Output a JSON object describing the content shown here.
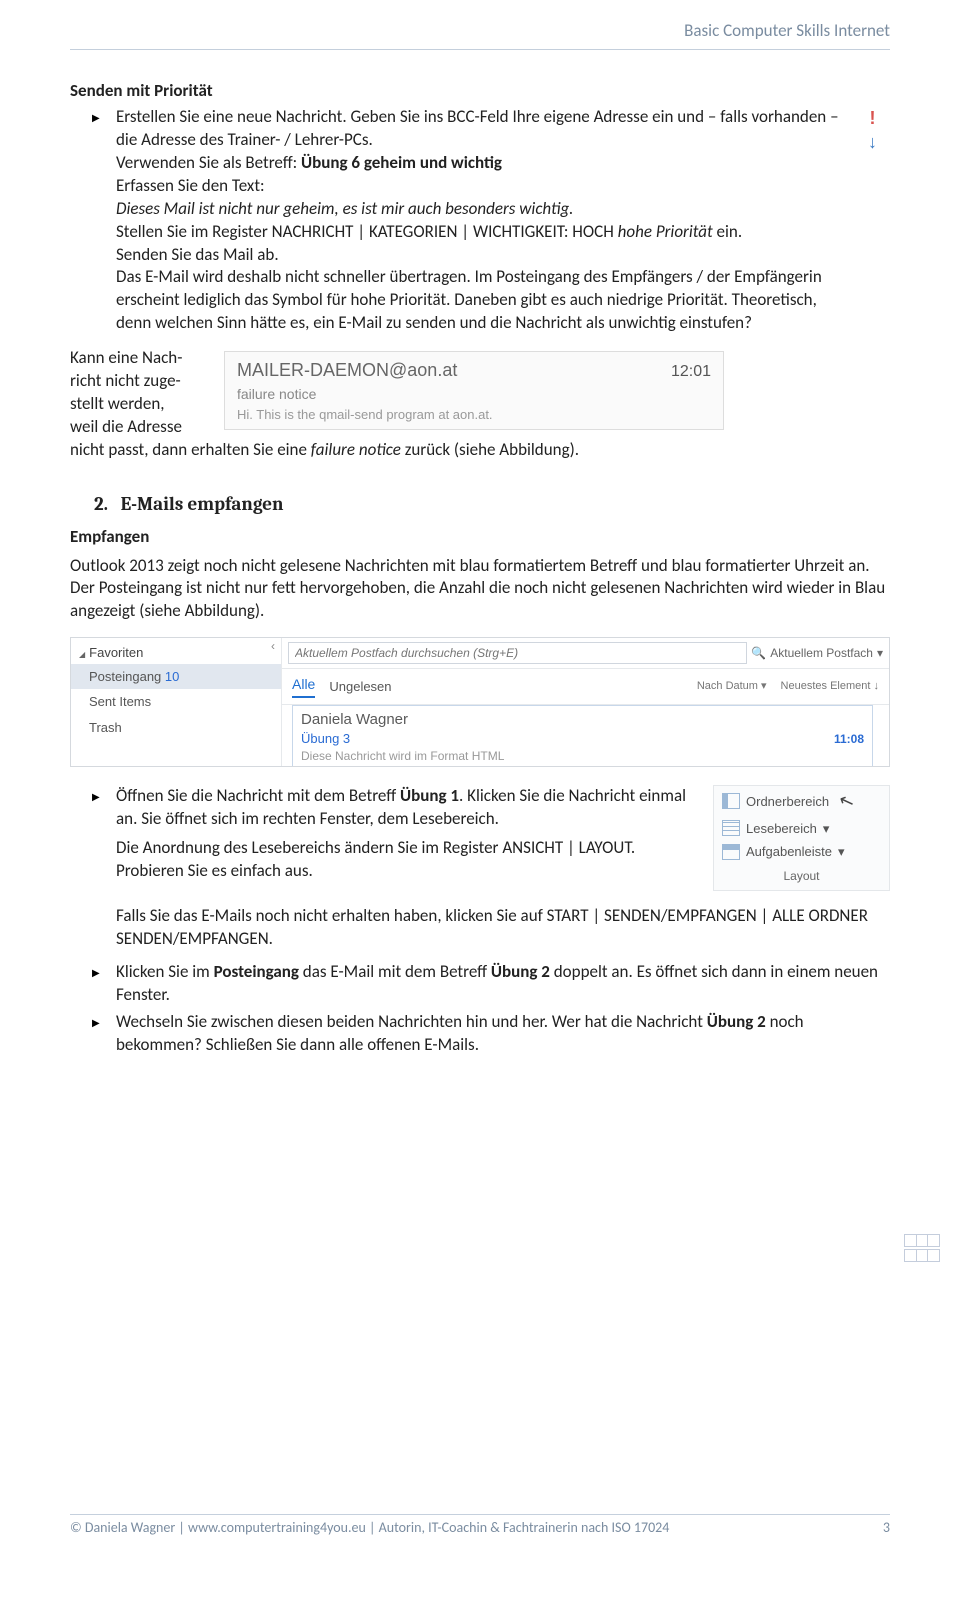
{
  "header": "Basic Computer Skills Internet",
  "sec1": {
    "title": "Senden mit Priorität",
    "b1_a": "Erstellen Sie eine neue Nachricht. Geben Sie ins BCC-Feld Ihre eigene Adresse ein und – falls vorhanden – die Adresse des Trainer- / Lehrer-PCs.",
    "b1_b": "Verwenden Sie als Betreff: ",
    "b1_b_bold": "Übung 6 geheim und wichtig",
    "b1_c": "Erfassen Sie den Text:",
    "b1_d": "Dieses Mail ist nicht nur geheim, es ist mir auch besonders wichtig.",
    "b1_e_a": "Stellen Sie im Register NACHRICHT | KATEGORIEN | WICHTIGKEIT: HOCH ",
    "b1_e_i": "hohe Priorität",
    "b1_e_b": " ein.",
    "b1_f": "Senden Sie das Mail ab.",
    "b1_g": "Das E-Mail wird deshalb nicht schneller übertragen. Im Posteingang des Empfängers / der Empfängerin erscheint lediglich das Symbol für hohe Priorität. Daneben gibt es auch  niedrige Priorität. Theoretisch, denn welchen Sinn hätte es, ein E-Mail zu senden und die Nachricht als unwichtig einstufen?"
  },
  "failure": {
    "side_a": "Kann eine Nach-",
    "side_b": "richt nicht zuge-",
    "side_c": "stellt werden,",
    "side_d": "weil die Adresse",
    "after": "nicht passt, dann erhalten Sie eine ",
    "after_i": "failure notice",
    "after_2": " zurück (siehe Abbildung).",
    "img": {
      "sender": "MAILER-DAEMON@aon.at",
      "subject": "failure notice",
      "time": "12:01",
      "body": "Hi. This is the qmail-send program at aon.at."
    }
  },
  "sec2": {
    "num": "2.",
    "title": "E-Mails empfangen",
    "sub": "Empfangen",
    "p1": "Outlook 2013 zeigt noch nicht gelesene Nachrichten mit blau formatiertem Betreff und blau formatierter Uhrzeit an. Der Posteingang ist nicht nur fett hervorgehoben, die Anzahl die noch nicht gelesenen Nachrichten wird wieder in Blau angezeigt (siehe Abbildung)."
  },
  "outlook": {
    "fav": "Favoriten",
    "inbox": "Posteingang",
    "inbox_n": "10",
    "sent": "Sent Items",
    "trash": "Trash",
    "search": "Aktuellem Postfach durchsuchen (Strg+E)",
    "scope": "Aktuellem Postfach",
    "alle": "Alle",
    "ungelesen": "Ungelesen",
    "nach": "Nach Datum",
    "neuest": "Neuestes Element",
    "msg": {
      "sender": "Daniela Wagner",
      "subject": "Übung 3",
      "time": "11:08",
      "body": "Diese Nachricht wird im Format HTML"
    }
  },
  "steps": {
    "s1_a": "Öffnen Sie die Nachricht mit dem Betreff ",
    "s1_b": "Übung 1",
    "s1_c": ". Klicken Sie die Nachricht einmal an. Sie öffnet sich im rechten Fenster, dem Lesebereich.",
    "s1_p2": "Die Anordnung des Lesebereichs ändern Sie im Register ANSICHT | LAYOUT. Probieren Sie es einfach aus.",
    "s1_p3": "Falls Sie das E-Mails noch nicht erhalten haben, klicken Sie auf START | SENDEN/EMPFANGEN | ALLE ORDNER SENDEN/EMPFANGEN.",
    "s2_a": "Klicken Sie im ",
    "s2_b": "Posteingang",
    "s2_c": " das E-Mail mit dem Betreff ",
    "s2_d": "Übung 2",
    "s2_e": " doppelt an. Es öffnet sich dann in einem neuen Fenster.",
    "s3_a": "Wechseln Sie zwischen diesen beiden Nachrichten hin und her. Wer hat die Nachricht ",
    "s3_b": "Übung 2",
    "s3_c": " noch bekommen? Schließen Sie dann alle offenen E-Mails."
  },
  "layout": {
    "folder": "Ordnerbereich",
    "read": "Lesebereich",
    "task": "Aufgabenleiste",
    "label": "Layout"
  },
  "footer": {
    "left": "© Daniela Wagner | www.computertraining4you.eu | Autorin, IT-Coachin & Fachtrainerin nach ISO 17024",
    "page": "3"
  }
}
